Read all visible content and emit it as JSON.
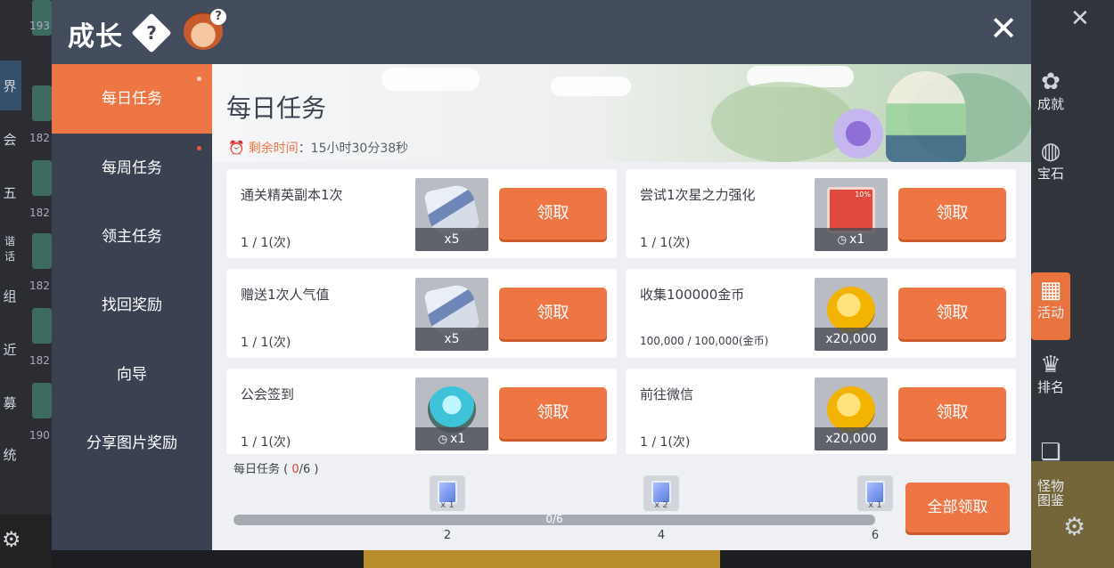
{
  "dialog": {
    "title": "成长",
    "help_label": "?",
    "avatar_badge": "?",
    "close_label": "✕"
  },
  "background": {
    "left_fragments": [
      "界",
      "会",
      "五",
      "谐话",
      "组",
      "近",
      "募",
      "统"
    ],
    "left_numbers": [
      "193",
      "182",
      "182",
      "182",
      "182",
      "190"
    ],
    "right_buttons": [
      {
        "icon": "maple-leaf-icon",
        "label": "成就"
      },
      {
        "icon": "globe-icon",
        "label": "宝石"
      },
      {
        "icon": "calendar-icon",
        "label": "活动"
      },
      {
        "icon": "trophy-icon",
        "label": "排名"
      },
      {
        "icon": "bookmark-icon",
        "label": "怪物\n图鉴"
      }
    ]
  },
  "sidebar": {
    "items": [
      {
        "label": "每日任务",
        "active": true,
        "dot": true
      },
      {
        "label": "每周任务",
        "active": false,
        "dot": true
      },
      {
        "label": "领主任务",
        "active": false,
        "dot": false
      },
      {
        "label": "找回奖励",
        "active": false,
        "dot": false
      },
      {
        "label": "向导",
        "active": false,
        "dot": false
      },
      {
        "label": "分享图片奖励",
        "active": false,
        "dot": false
      }
    ]
  },
  "main": {
    "heading": "每日任务",
    "timer_label": "剩余时间",
    "timer_value": "：15小时30分38秒",
    "claim_label": "领取",
    "tasks": [
      {
        "name": "通关精英副本1次",
        "progress": "1 / 1(次)",
        "reward_qty": "x5",
        "reward_icon": "scroll",
        "timed": false
      },
      {
        "name": "尝试1次星之力强化",
        "progress": "1 / 1(次)",
        "reward_qty": "x1",
        "reward_icon": "red-card",
        "reward_tag": "10%",
        "timed": true
      },
      {
        "name": "赠送1次人气值",
        "progress": "1 / 1(次)",
        "reward_qty": "x5",
        "reward_icon": "scroll",
        "timed": false
      },
      {
        "name": "收集100000金币",
        "progress": "100,000 / 100,000(金币)",
        "reward_qty": "x20,000",
        "reward_icon": "gold-coin",
        "timed": false
      },
      {
        "name": "公会签到",
        "progress": "1 / 1(次)",
        "reward_qty": "x1",
        "reward_icon": "blue-stone",
        "timed": true
      },
      {
        "name": "前往微信",
        "progress": "1 / 1(次)",
        "reward_qty": "x20,000",
        "reward_icon": "gold-coin",
        "timed": false
      }
    ]
  },
  "progress": {
    "label_prefix": "每日任务 ( ",
    "current": "0",
    "label_suffix": "/6 )",
    "track_text": "0/6",
    "fraction": 0,
    "milestones": [
      {
        "step": "2",
        "qty": "x 1"
      },
      {
        "step": "4",
        "qty": "x 2"
      },
      {
        "step": "6",
        "qty": "x 1"
      }
    ],
    "claim_all_label": "全部领取"
  },
  "colors": {
    "accent": "#ee7645",
    "header": "#434c5c",
    "sidebar": "#3a4252",
    "content": "#eef0f3",
    "alert": "#e0452e"
  }
}
